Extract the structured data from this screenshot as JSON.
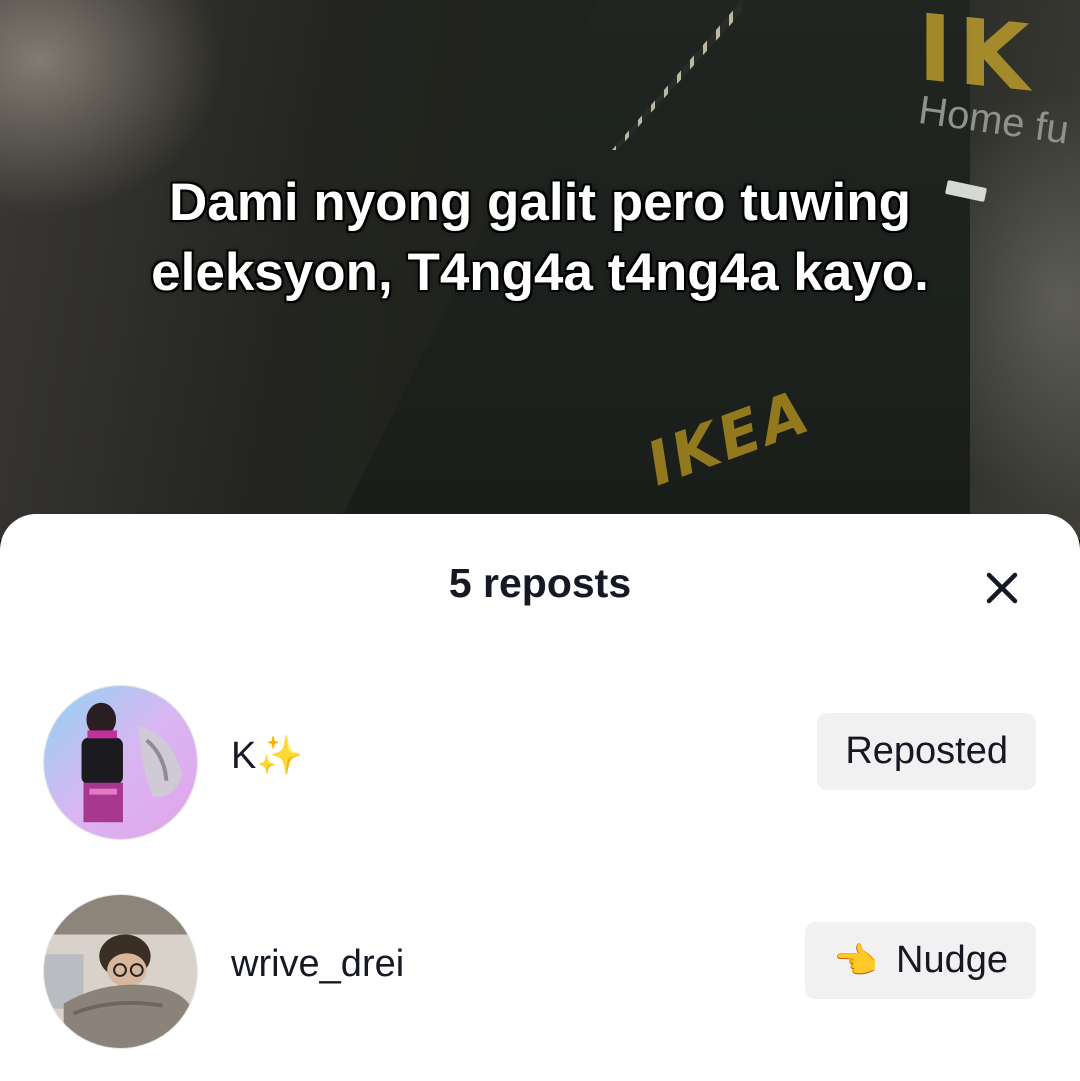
{
  "video": {
    "caption": "Dami nyong galit pero tuwing eleksyon, T4ng4a t4ng4a kayo.",
    "sign_top": "IK",
    "sign_home": "Home fu",
    "sign_bottom": "IKEA"
  },
  "sheet": {
    "title": "5 reposts",
    "close_icon": "close-icon",
    "users": [
      {
        "username": "K✨",
        "action_label": "Reposted",
        "action_icon": ""
      },
      {
        "username": "wrive_drei",
        "action_label": "Nudge",
        "action_icon": "👈"
      }
    ]
  },
  "colors": {
    "sheet_bg": "#ffffff",
    "text": "#161823",
    "button_bg": "#f1f1f2",
    "sign_yellow": "#b99a2a"
  }
}
